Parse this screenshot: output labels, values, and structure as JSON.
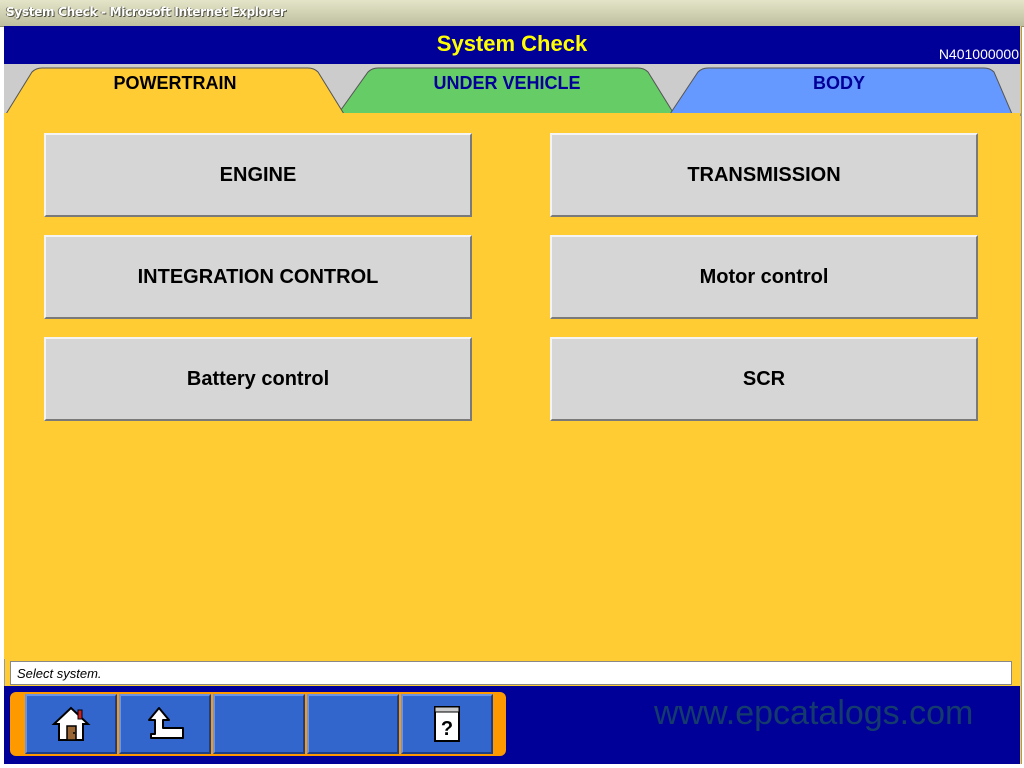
{
  "window": {
    "title": "System Check - Microsoft Internet Explorer"
  },
  "header": {
    "title": "System Check",
    "screen_code": "N401000000"
  },
  "tabs": [
    {
      "label": "POWERTRAIN",
      "color": "#ffcc33",
      "text_color": "#000000",
      "active": true
    },
    {
      "label": "UNDER VEHICLE",
      "color": "#66cc66",
      "text_color": "#000099",
      "active": false
    },
    {
      "label": "BODY",
      "color": "#6699ff",
      "text_color": "#000099",
      "active": false
    }
  ],
  "systems": [
    {
      "label": "ENGINE"
    },
    {
      "label": "TRANSMISSION"
    },
    {
      "label": "INTEGRATION CONTROL"
    },
    {
      "label": "Motor control"
    },
    {
      "label": "Battery control"
    },
    {
      "label": "SCR"
    }
  ],
  "status": {
    "message": "Select system."
  },
  "footer": {
    "buttons": [
      {
        "icon": "home-icon"
      },
      {
        "icon": "back-arrow-icon"
      },
      {
        "icon": ""
      },
      {
        "icon": ""
      },
      {
        "icon": "help-icon"
      }
    ]
  },
  "watermark": "www.epcatalogs.com",
  "colors": {
    "header_bg": "#000099",
    "title": "#ffff00",
    "panel": "#ffcc33",
    "button": "#d6d6d6",
    "footer_button": "#3366cc"
  }
}
